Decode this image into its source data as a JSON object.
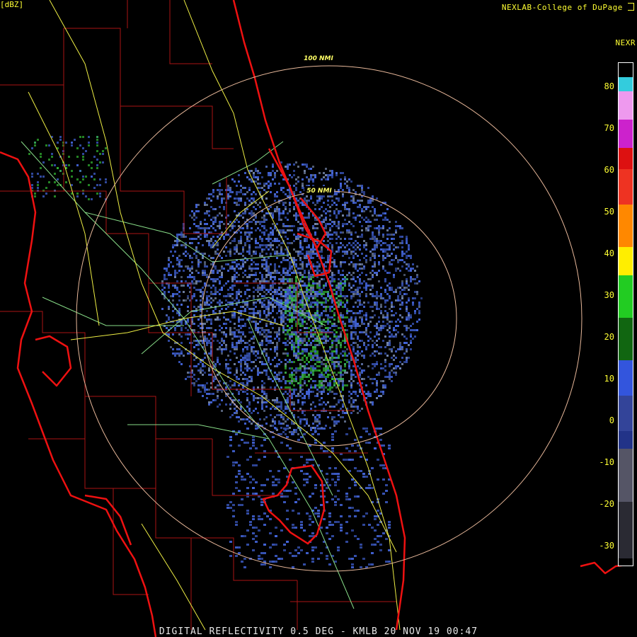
{
  "header": {
    "credit": "NEXLAB-College of DuPage",
    "product": "NEXR",
    "units": "[dBZ]"
  },
  "range_rings": [
    {
      "label": "100 NMI"
    },
    {
      "label": "50 NMI"
    }
  ],
  "legend": {
    "ticks": [
      "80",
      "70",
      "60",
      "50",
      "40",
      "30",
      "20",
      "10",
      "0",
      "-10",
      "-20",
      "-30"
    ],
    "colors": {
      "cyan": "#33ccdd",
      "magenta": "#cc22cc",
      "red": "#dd1111",
      "orange": "#ff8800",
      "yellow": "#ffee00",
      "green": "#22cc22",
      "darkgreen": "#116611",
      "blue": "#3355dd",
      "navy": "#223388",
      "gray": "#555566",
      "black": "#000000"
    }
  },
  "footer": {
    "caption": "DIGITAL REFLECTIVITY 0.5 DEG - KMLB 20 NOV 19 00:47"
  },
  "map_colors": {
    "coast": "#ee1111",
    "counties": "#aa1515",
    "highways": "#eeee44",
    "roads": "#88dd88",
    "rings": "#e8b89a",
    "echo_blue": "#4466dd",
    "echo_green": "#33bb33",
    "echo_gray": "#7788aa"
  }
}
